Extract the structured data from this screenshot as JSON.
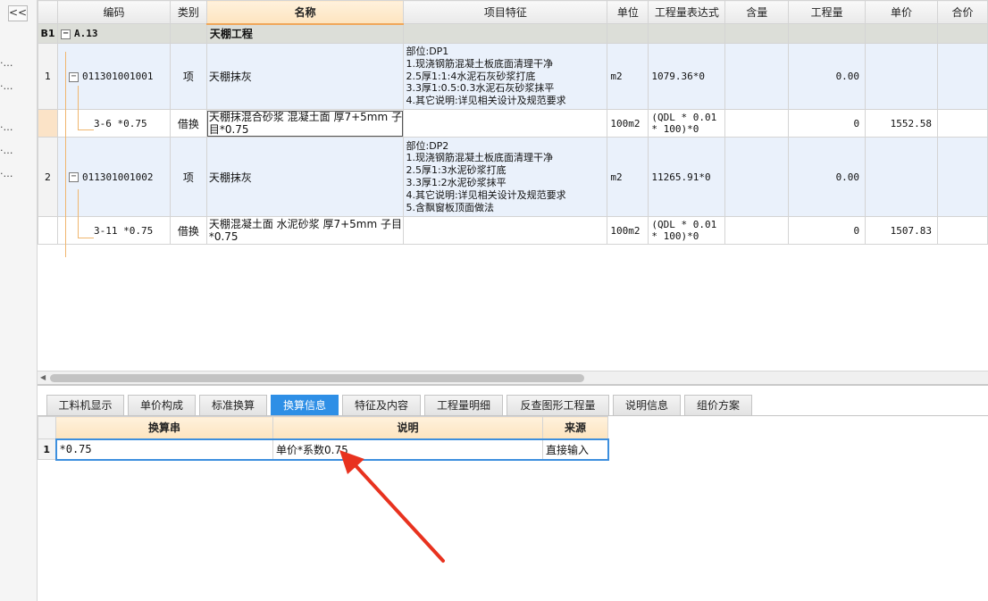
{
  "sidebar": {
    "collapse_label": "<<"
  },
  "table": {
    "columns": [
      "编码",
      "类别",
      "名称",
      "项目特征",
      "单位",
      "工程量表达式",
      "含量",
      "工程量",
      "单价",
      "合价"
    ],
    "section": {
      "rownum": "B1",
      "code": "A.13",
      "name": "天棚工程"
    },
    "rows": [
      {
        "rownum": "1",
        "code": "011301001001",
        "type": "项",
        "name": "天棚抹灰",
        "features": "部位:DP1\n1.现浇钢筋混凝土板底面清理干净\n2.5厚1:1:4水泥石灰砂浆打底\n3.3厚1:0.5:0.3水泥石灰砂浆抹平\n4.其它说明:详见相关设计及规范要求",
        "unit": "m2",
        "expr": "1079.36*0",
        "content": "",
        "qty": "0.00",
        "price": "",
        "total": ""
      },
      {
        "rownum": "",
        "code": "3-6 *0.75",
        "type": "借换",
        "name": "天棚抹混合砂浆 混凝土面 厚7+5mm 子目*0.75",
        "features": "",
        "unit": "100m2",
        "expr": "(QDL * 0.01 * 100)*0",
        "content": "",
        "qty": "0",
        "price": "1552.58",
        "total": ""
      },
      {
        "rownum": "2",
        "code": "011301001002",
        "type": "项",
        "name": "天棚抹灰",
        "features": "部位:DP2\n1.现浇钢筋混凝土板底面清理干净\n2.5厚1:3水泥砂浆打底\n3.3厚1:2水泥砂浆抹平\n4.其它说明:详见相关设计及规范要求\n5.含飘窗板顶面做法",
        "unit": "m2",
        "expr": "11265.91*0",
        "content": "",
        "qty": "0.00",
        "price": "",
        "total": ""
      },
      {
        "rownum": "",
        "code": "3-11 *0.75",
        "type": "借换",
        "name": "天棚混凝土面 水泥砂浆 厚7+5mm 子目*0.75",
        "features": "",
        "unit": "100m2",
        "expr": "(QDL * 0.01 * 100)*0",
        "content": "",
        "qty": "0",
        "price": "1507.83",
        "total": ""
      }
    ]
  },
  "bottom": {
    "tabs": [
      "工料机显示",
      "单价构成",
      "标准换算",
      "换算信息",
      "特征及内容",
      "工程量明细",
      "反查图形工程量",
      "说明信息",
      "组价方案"
    ],
    "active_tab": "换算信息",
    "sub_table": {
      "headers": [
        "换算串",
        "说明",
        "来源"
      ],
      "rows": [
        {
          "rownum": "1",
          "expr": "*0.75",
          "desc": "单价*系数0.75",
          "source": "直接输入"
        }
      ]
    }
  },
  "colors": {
    "active_tab": "#2e8fe6",
    "header_highlight": "#fde4bf",
    "arrow": "#e8321f",
    "item_row": "#eaf1fb"
  },
  "icons": {
    "collapse": "double-chevron-left-icon",
    "tree_toggle": "minus-box-icon",
    "annotation": "red-arrow-icon"
  }
}
